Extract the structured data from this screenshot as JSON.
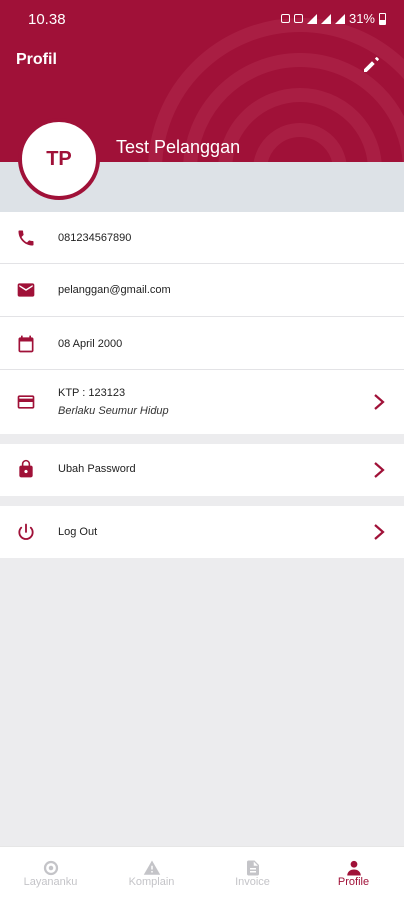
{
  "status_bar": {
    "time": "10.38",
    "battery": "31%"
  },
  "header": {
    "title": "Profil",
    "edit_icon": "pencil-icon"
  },
  "profile": {
    "initials": "TP",
    "name": "Test Pelanggan"
  },
  "info_rows": {
    "phone": {
      "icon": "phone-icon",
      "value": "081234567890"
    },
    "email": {
      "icon": "mail-icon",
      "value": "pelanggan@gmail.com"
    },
    "birthdate": {
      "icon": "calendar-icon",
      "value": "08 April 2000"
    },
    "ktp": {
      "icon": "card-icon",
      "value": "KTP : 123123",
      "validity": "Berlaku Seumur Hidup"
    }
  },
  "actions": {
    "change_password": {
      "icon": "lock-icon",
      "label": "Ubah Password"
    },
    "logout": {
      "icon": "power-icon",
      "label": "Log Out"
    }
  },
  "bottom_nav": [
    {
      "label": "Layananku",
      "icon": "service-icon",
      "active": false
    },
    {
      "label": "Komplain",
      "icon": "warning-icon",
      "active": false
    },
    {
      "label": "Invoice",
      "icon": "document-icon",
      "active": false
    },
    {
      "label": "Profile",
      "icon": "person-icon",
      "active": true
    }
  ],
  "colors": {
    "primary": "#a01138",
    "background": "#ececee",
    "band": "#dde2e7",
    "inactive": "#c4c4c8"
  }
}
